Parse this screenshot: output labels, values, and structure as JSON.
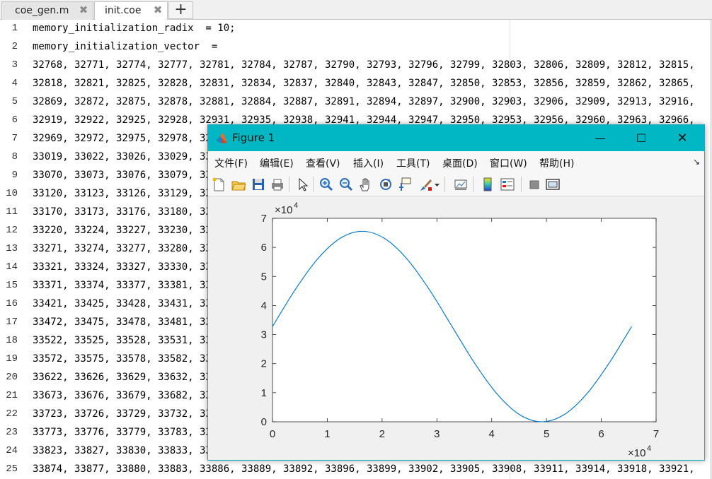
{
  "editor": {
    "tabs": [
      {
        "label": "coe_gen.m",
        "close": "✖"
      },
      {
        "label": "init.coe",
        "close": "✖"
      }
    ],
    "add_tab": "+",
    "lines": [
      {
        "num": "1",
        "text": "memory_initialization_radix  = 10;"
      },
      {
        "num": "2",
        "text": "memory_initialization_vector  ="
      },
      {
        "num": "3",
        "text": "32768, 32771, 32774, 32777, 32781, 32784, 32787, 32790, 32793, 32796, 32799, 32803, 32806, 32809, 32812, 32815,"
      },
      {
        "num": "4",
        "text": "32818, 32821, 32825, 32828, 32831, 32834, 32837, 32840, 32843, 32847, 32850, 32853, 32856, 32859, 32862, 32865,"
      },
      {
        "num": "5",
        "text": "32869, 32872, 32875, 32878, 32881, 32884, 32887, 32891, 32894, 32897, 32900, 32903, 32906, 32909, 32913, 32916,"
      },
      {
        "num": "6",
        "text": "32919, 32922, 32925, 32928, 32931, 32935, 32938, 32941, 32944, 32947, 32950, 32953, 32956, 32960, 32963, 32966,"
      },
      {
        "num": "7",
        "text": "32969, 32972, 32975, 32978, 3298"
      },
      {
        "num": "8",
        "text": "33019, 33022, 33026, 33029, 3303"
      },
      {
        "num": "9",
        "text": "33070, 33073, 33076, 33079, 3308"
      },
      {
        "num": "10",
        "text": "33120, 33123, 33126, 33129, 3313"
      },
      {
        "num": "11",
        "text": "33170, 33173, 33176, 33180, 3318"
      },
      {
        "num": "12",
        "text": "33220, 33224, 33227, 33230, 3323"
      },
      {
        "num": "13",
        "text": "33271, 33274, 33277, 33280, 3328"
      },
      {
        "num": "14",
        "text": "33321, 33324, 33327, 33330, 3333"
      },
      {
        "num": "15",
        "text": "33371, 33374, 33377, 33381, 3338"
      },
      {
        "num": "16",
        "text": "33421, 33425, 33428, 33431, 3343"
      },
      {
        "num": "17",
        "text": "33472, 33475, 33478, 33481, 3348"
      },
      {
        "num": "18",
        "text": "33522, 33525, 33528, 33531, 3353"
      },
      {
        "num": "19",
        "text": "33572, 33575, 33578, 33582, 3358"
      },
      {
        "num": "20",
        "text": "33622, 33626, 33629, 33632, 3363"
      },
      {
        "num": "21",
        "text": "33673, 33676, 33679, 33682, 3368"
      },
      {
        "num": "22",
        "text": "33723, 33726, 33729, 33732, 3373"
      },
      {
        "num": "23",
        "text": "33773, 33776, 33779, 33783, 3378"
      },
      {
        "num": "24",
        "text": "33823, 33827, 33830, 33833, 3383"
      },
      {
        "num": "25",
        "text": "33874, 33877, 33880, 33883, 33886, 33889, 33892, 33896, 33899, 33902, 33905, 33908, 33911, 33914, 33918, 33921,"
      }
    ]
  },
  "figure": {
    "title": "Figure 1",
    "minimize": "—",
    "maximize": "☐",
    "close": "✕",
    "menus": [
      "文件(F)",
      "编辑(E)",
      "查看(V)",
      "插入(I)",
      "工具(T)",
      "桌面(D)",
      "窗口(W)",
      "帮助(H)"
    ],
    "menu_overflow": "↘",
    "toolbar_icons": [
      "new-figure-icon",
      "open-file-icon",
      "save-icon",
      "print-icon",
      "select-arrow-icon",
      "zoom-in-icon",
      "zoom-out-icon",
      "pan-icon",
      "rotate-3d-icon",
      "data-cursor-icon",
      "brush-icon",
      "brush-dropdown-icon",
      "link-plot-icon",
      "colorbar-icon",
      "legend-icon",
      "hide-plot-tools-icon",
      "show-plot-tools-icon"
    ],
    "colors": {
      "titlebar": "#00b7c3",
      "line": "#0072bd"
    }
  },
  "chart_data": {
    "type": "line",
    "title": "",
    "xlabel": "",
    "ylabel": "",
    "x_exponent_label": "×10",
    "x_exponent": "4",
    "y_exponent_label": "×10",
    "y_exponent": "4",
    "xlim": [
      0,
      70000
    ],
    "ylim": [
      0,
      70000
    ],
    "xticks": [
      0,
      10000,
      20000,
      30000,
      40000,
      50000,
      60000,
      70000
    ],
    "xtick_labels": [
      "0",
      "1",
      "2",
      "3",
      "4",
      "5",
      "6",
      "7"
    ],
    "yticks": [
      0,
      10000,
      20000,
      30000,
      40000,
      50000,
      60000,
      70000
    ],
    "ytick_labels": [
      "0",
      "1",
      "2",
      "3",
      "4",
      "5",
      "6",
      "7"
    ],
    "grid": false,
    "series": [
      {
        "color": "#0072bd",
        "x": [
          0,
          4096,
          8192,
          12288,
          16384,
          20480,
          24576,
          28672,
          32768,
          36864,
          40960,
          45056,
          49152,
          53248,
          57344,
          61440,
          65535
        ],
        "y": [
          32768,
          45308,
          55938,
          63040,
          65535,
          63040,
          55938,
          45308,
          32768,
          20228,
          9598,
          2496,
          0,
          2496,
          9598,
          20228,
          32765
        ]
      }
    ]
  }
}
